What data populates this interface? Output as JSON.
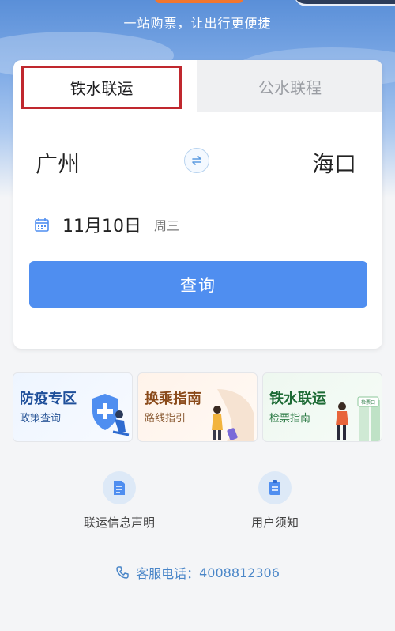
{
  "header": {
    "slogan": "一站购票，让出行更便捷"
  },
  "tabs": [
    {
      "label": "铁水联运",
      "active": true
    },
    {
      "label": "公水联程",
      "active": false
    }
  ],
  "route": {
    "from": "广州",
    "to": "海口"
  },
  "date": {
    "value": "11月10日",
    "weekday": "周三"
  },
  "search_button": "查询",
  "tiles": [
    {
      "title": "防疫专区",
      "subtitle": "政策查询",
      "icon": "shield-medical-illustration"
    },
    {
      "title": "换乘指南",
      "subtitle": "路线指引",
      "icon": "traveler-luggage-illustration"
    },
    {
      "title": "铁水联运",
      "subtitle": "检票指南",
      "icon": "ticket-check-illustration",
      "badge": "检票口"
    }
  ],
  "links": [
    {
      "label": "联运信息声明",
      "icon": "document-icon"
    },
    {
      "label": "用户须知",
      "icon": "notice-icon"
    }
  ],
  "service": {
    "label": "客服电话：",
    "phone": "4008812306"
  },
  "colors": {
    "primary": "#4f8ef0",
    "active_tab_border": "#c0282e",
    "link_text": "#4a86c8"
  }
}
